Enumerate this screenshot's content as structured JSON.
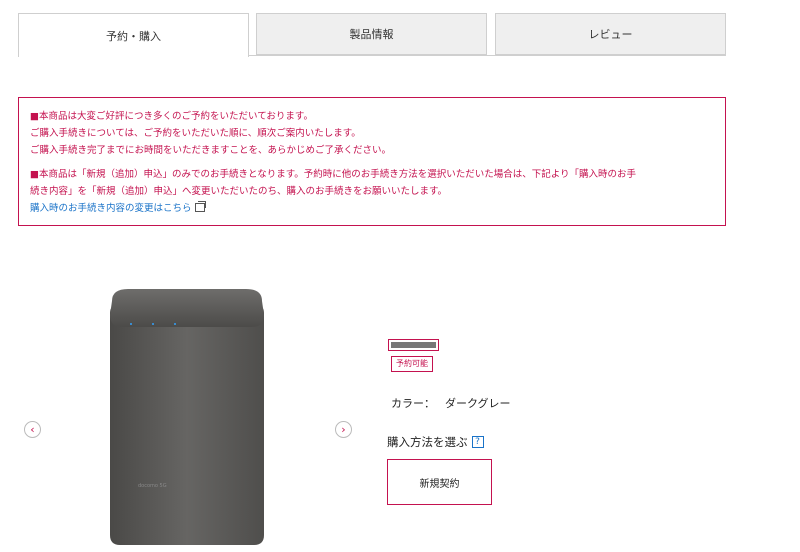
{
  "tabs": [
    {
      "label": "予約・購入",
      "active": true
    },
    {
      "label": "製品情報",
      "active": false
    },
    {
      "label": "レビュー",
      "active": false
    }
  ],
  "notice": {
    "line1": "■本商品は大変ご好評につき多くのご予約をいただいております。",
    "line2": "ご購入手続きについては、ご予約をいただいた順に、順次ご案内いたします。",
    "line3": "ご購入手続き完了までにお時間をいただきますことを、あらかじめご了承ください。",
    "line4": "■本商品は「新規（追加）申込」のみでのお手続きとなります。予約時に他のお手続き方法を選択いただいた場合は、下記より「購入時のお手",
    "line5": "続き内容」を「新規（追加）申込」へ変更いただいたのち、購入のお手続きをお願いいたします。",
    "link": "購入時のお手続き内容の変更はこちら"
  },
  "carousel": {
    "prev_icon": "chevron-left-icon",
    "next_icon": "chevron-right-icon",
    "product_text": "docomo 5G"
  },
  "product": {
    "status": "予約可能",
    "color_label": "カラー：",
    "color_value": "ダークグレー",
    "purchase_title": "購入方法を選ぶ",
    "help": "?",
    "option_label": "新規契約"
  },
  "colors": {
    "accent": "#c4124f",
    "link": "#1a73c8",
    "device": "#5b5a58"
  }
}
